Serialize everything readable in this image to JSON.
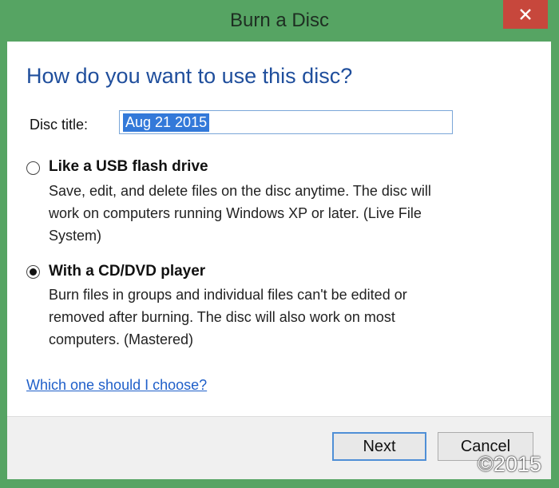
{
  "window": {
    "title": "Burn a Disc",
    "close_icon": "close-icon"
  },
  "dialog": {
    "heading": "How do you want to use this disc?",
    "disc_title_label": "Disc title:",
    "disc_title_value": "Aug 21 2015",
    "options": [
      {
        "title": "Like a USB flash drive",
        "description_lines": [
          "Save, edit, and delete files on the disc anytime. The disc will",
          "work on computers running Windows XP or later. (Live File",
          "System)"
        ],
        "selected": false
      },
      {
        "title": "With a CD/DVD player",
        "description_lines": [
          "Burn files in groups and individual files can't be edited or",
          "removed after burning. The disc will also work on most",
          "computers. (Mastered)"
        ],
        "selected": true
      }
    ],
    "help_link": "Which one should I choose?"
  },
  "buttons": {
    "next_label": "Next",
    "cancel_label": "Cancel"
  },
  "watermark": "©2015"
}
